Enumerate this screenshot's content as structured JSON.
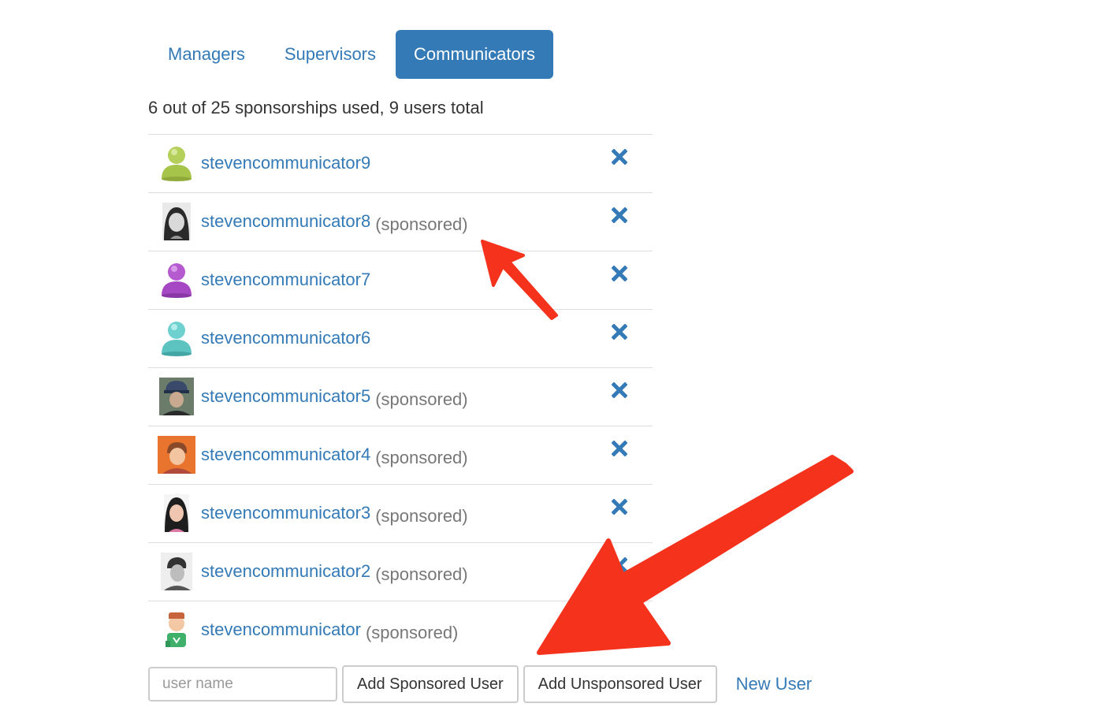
{
  "tabs": [
    {
      "label": "Managers",
      "active": false
    },
    {
      "label": "Supervisors",
      "active": false
    },
    {
      "label": "Communicators",
      "active": true
    }
  ],
  "summary": "6 out of 25 sponsorships used, 9 users total",
  "users": [
    {
      "name": "stevencommunicator9",
      "sponsored_label": "",
      "avatar": "green-person-icon",
      "removable": true
    },
    {
      "name": "stevencommunicator8",
      "sponsored_label": "(sponsored)",
      "avatar": "photo-avatar",
      "removable": true
    },
    {
      "name": "stevencommunicator7",
      "sponsored_label": "",
      "avatar": "purple-person-icon",
      "removable": true
    },
    {
      "name": "stevencommunicator6",
      "sponsored_label": "",
      "avatar": "teal-person-icon",
      "removable": true
    },
    {
      "name": "stevencommunicator5",
      "sponsored_label": "(sponsored)",
      "avatar": "photo-avatar",
      "removable": true
    },
    {
      "name": "stevencommunicator4",
      "sponsored_label": "(sponsored)",
      "avatar": "photo-avatar",
      "removable": true
    },
    {
      "name": "stevencommunicator3",
      "sponsored_label": "(sponsored)",
      "avatar": "photo-avatar",
      "removable": true
    },
    {
      "name": "stevencommunicator2",
      "sponsored_label": "(sponsored)",
      "avatar": "photo-avatar",
      "removable": true
    },
    {
      "name": "stevencommunicator",
      "sponsored_label": "(sponsored)",
      "avatar": "cartoon-avatar",
      "removable": false
    }
  ],
  "footer": {
    "username_placeholder": "user name",
    "add_sponsored_label": "Add Sponsored User",
    "add_unsponsored_label": "Add Unsponsored User",
    "new_user_label": "New User"
  },
  "colors": {
    "link": "#337ab7",
    "active_tab_bg": "#337ab7",
    "muted_text": "#777777",
    "divider": "#dddddd",
    "annotation_arrow": "#f5321c"
  },
  "icons": {
    "remove": "close-x-icon",
    "annotation": "red-arrow-icon"
  }
}
